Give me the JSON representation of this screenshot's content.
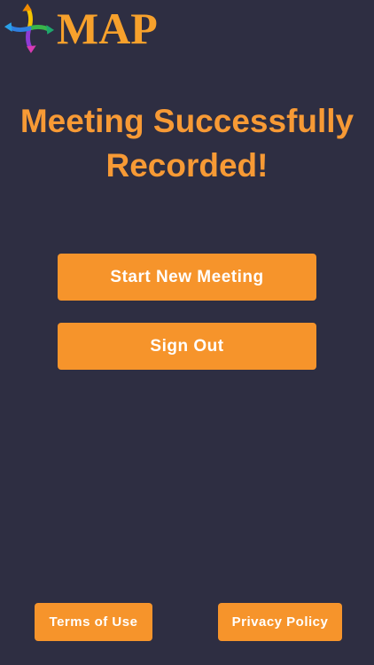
{
  "brand": {
    "name": "MAP",
    "color": "#f7a12c"
  },
  "headline": {
    "line1": "Meeting Successfully",
    "line2": "Recorded!",
    "color": "#f79a35"
  },
  "actions": {
    "start_new_meeting": "Start New Meeting",
    "sign_out": "Sign Out"
  },
  "footer": {
    "terms": "Terms of Use",
    "privacy": "Privacy Policy"
  },
  "colors": {
    "background": "#2e2e42",
    "button": "#f6942b",
    "button_text": "#ffffff"
  },
  "icons": {
    "logo": "pinwheel-arrows-icon"
  }
}
